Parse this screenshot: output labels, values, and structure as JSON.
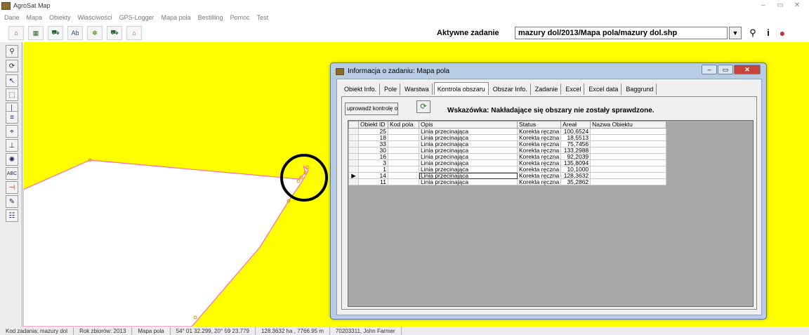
{
  "app": {
    "title": "AgroSat Map"
  },
  "menu": [
    "Dane",
    "Mapa",
    "Obiekty",
    "Właściwości",
    "GPS-Logger",
    "Mapa pola",
    "Bestilling",
    "Pomoc",
    "Test"
  ],
  "toolbar": {
    "task_label": "Aktywne zadanie",
    "task_value": "mazury dol/2013/Mapa pola/mazury dol.shp"
  },
  "colors": {
    "map_background": "#ffff00",
    "field_outline": "#ff69b4",
    "annotation_circle": "#000000"
  },
  "dialog": {
    "title": "Informacja o zadaniu: Mapa pola",
    "tabs": [
      "Obiekt Info.",
      "Pole",
      "Warstwa",
      "Kontrola obszaru",
      "Obszar Info.",
      "Zadanie",
      "Excel",
      "Excel data",
      "Baggrund"
    ],
    "active_tab": "Kontrola obszaru",
    "run_button": "uprowadź kontrolę obszaru",
    "hint": "Wskazówka: Nakładające się obszary nie zostały sprawdzone.",
    "columns": [
      "Obiekt ID",
      "Kod pola",
      "Opis",
      "Status",
      "Areał",
      "Nazwa Obiektu"
    ],
    "rows": [
      [
        "25",
        "",
        "Linia przecinająca",
        "Korekta ręczna",
        "100,6524",
        ""
      ],
      [
        "18",
        "",
        "Linia przecinająca",
        "Korekta ręczna",
        "18,5513",
        ""
      ],
      [
        "33",
        "",
        "Linia przecinająca",
        "Korekta ręczna",
        "75,7456",
        ""
      ],
      [
        "30",
        "",
        "Linia przecinająca",
        "Korekta ręczna",
        "133,2988",
        ""
      ],
      [
        "16",
        "",
        "Linia przecinająca",
        "Korekta ręczna",
        "92,2039",
        ""
      ],
      [
        "3",
        "",
        "Linia przecinająca",
        "Korekta ręczna",
        "135,8094",
        ""
      ],
      [
        "1",
        "",
        "Linia przecinająca",
        "Korekta ręczna",
        "10,1000",
        ""
      ],
      [
        "14",
        "",
        "Linia przecinająca",
        "Korekta ręczna",
        "128,3632",
        ""
      ],
      [
        "11",
        "",
        "Linia przecinająca",
        "Korekta ręczna",
        "35,2862",
        ""
      ]
    ],
    "current_row": 7
  },
  "status": {
    "kod_zadania": "Kod zadania: mazury dol",
    "rok": "Rok zbiorów: 2013",
    "layer": "Mapa pola",
    "coords": "54° 01 32.299, 20° 59 23.779",
    "area": "128.3632 ha , 7766.95 m",
    "user": "70203311, John Farmer"
  }
}
